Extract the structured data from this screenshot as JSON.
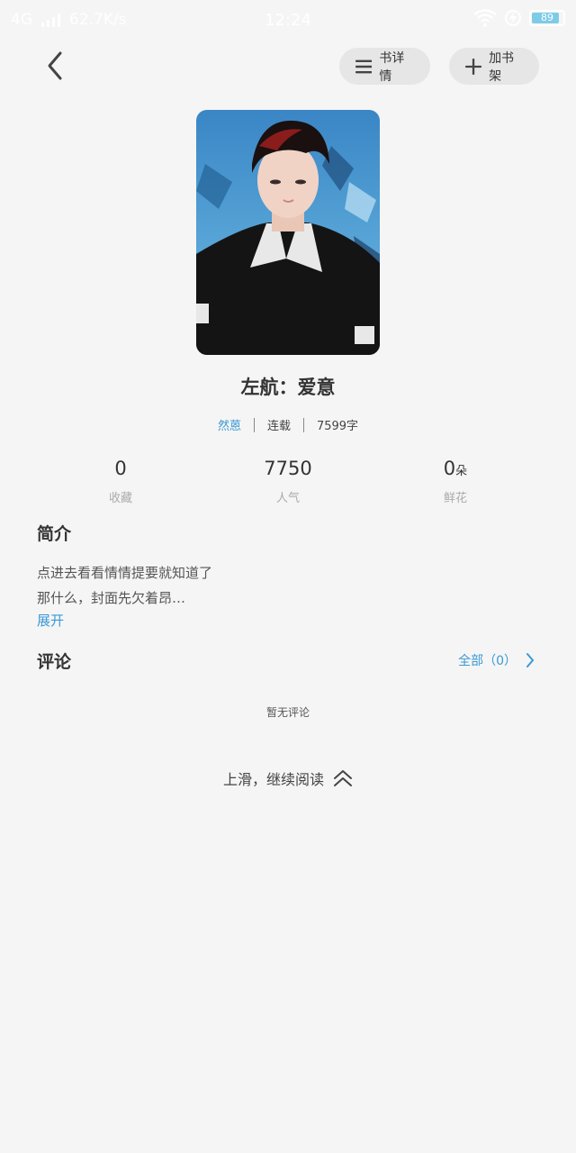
{
  "statusbar": {
    "network": "4G",
    "speed": "62.7K/s",
    "time": "12:24",
    "battery": "89"
  },
  "nav": {
    "detail_label": "书详情",
    "add_label": "加书架"
  },
  "book": {
    "title": "左航：爱意",
    "author": "然蒽",
    "status": "连载",
    "word_count": "7599字"
  },
  "stats": [
    {
      "value": "0",
      "unit": "",
      "label": "收藏"
    },
    {
      "value": "7750",
      "unit": "",
      "label": "人气"
    },
    {
      "value": "0",
      "unit": "朵",
      "label": "鲜花"
    }
  ],
  "intro": {
    "heading": "简介",
    "line1": "点进去看看情情提要就知道了",
    "line2": "那什么，封面先欠着昂…",
    "expand_label": "展开"
  },
  "comments": {
    "heading": "评论",
    "all_label": "全部（0）",
    "empty_text": "暂无评论"
  },
  "footer": {
    "continue_label": "上滑，继续阅读"
  },
  "colors": {
    "accent": "#3a9ad4",
    "background": "#f5f5f5",
    "pill": "#e6e6e6"
  }
}
